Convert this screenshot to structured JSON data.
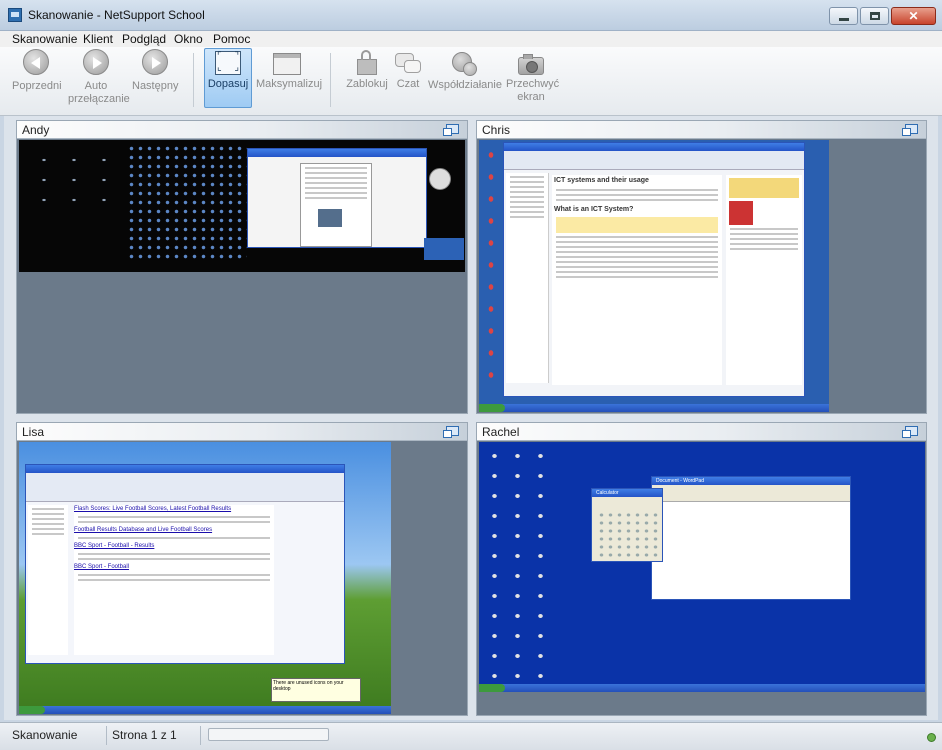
{
  "window": {
    "title": "Skanowanie - NetSupport School"
  },
  "menu": [
    "Skanowanie",
    "Klient",
    "Podgląd",
    "Okno",
    "Pomoc"
  ],
  "toolbar": {
    "prev_label": "Poprzedni",
    "auto_label_1": "Auto",
    "auto_label_2": "przełączanie",
    "next_label": "Następny",
    "fit_label": "Dopasuj",
    "maximize_label": "Maksymalizuj",
    "lock_label": "Zablokuj",
    "chat_label": "Czat",
    "collab_label": "Współdziałanie",
    "capture_label_1": "Przechwyć",
    "capture_label_2": "ekran"
  },
  "clients": [
    {
      "name": "Andy",
      "screen": "dark desktop with many icons and a document window"
    },
    {
      "name": "Chris",
      "screen": "Internet Explorer: GCSE ICT - ICT systems and their usage"
    },
    {
      "name": "Lisa",
      "screen": "Internet Explorer: google search 'football results' over green hills wallpaper"
    },
    {
      "name": "Rachel",
      "screen": "blue desktop with Calculator and WordPad windows"
    }
  ],
  "chris_page": {
    "heading": "ICT systems and their usage",
    "subheading": "What is an ICT System?"
  },
  "lisa_page": {
    "result1": "Flash Scores: Live Football Scores, Latest Football Results",
    "result2": "Football Results Database and Live Football Scores",
    "result3": "BBC Sport - Football - Results",
    "result4": "BBC Sport - Football",
    "balloon": "There are unused icons on your desktop"
  },
  "rachel_page": {
    "calc_title": "Calculator",
    "wordpad_title": "Document - WordPad"
  },
  "status": {
    "mode": "Skanowanie",
    "page": "Strona 1 z 1"
  }
}
